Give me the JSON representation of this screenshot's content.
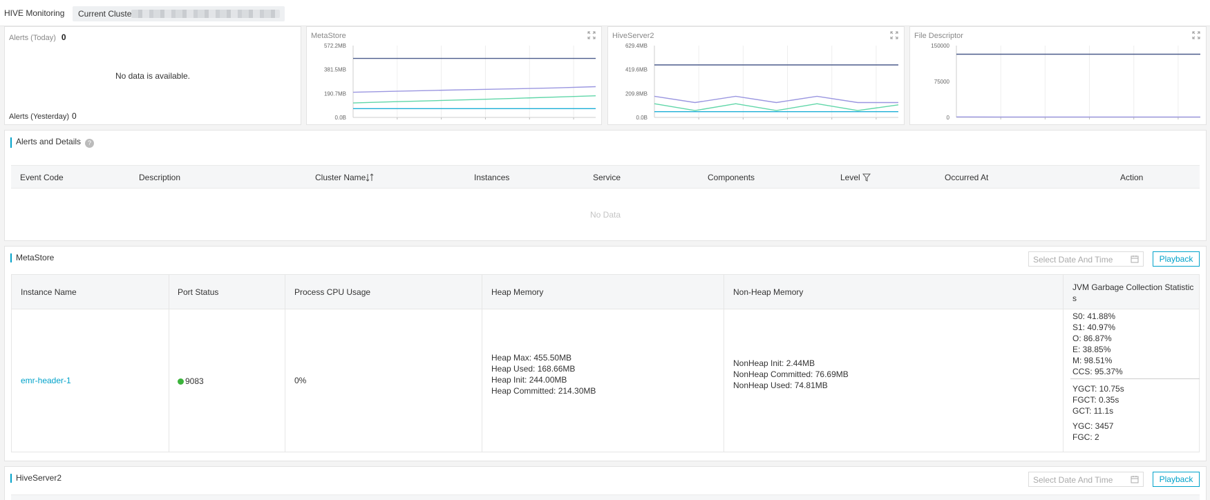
{
  "topbar": {
    "title": "HIVE Monitoring",
    "cluster_label": "Current Cluster"
  },
  "alerts_card": {
    "today_label": "Alerts (Today)",
    "today_count": "0",
    "no_data": "No data is available.",
    "yesterday_label": "Alerts (Yesterday)",
    "yesterday_count": "0"
  },
  "charts": [
    {
      "title": "MetaStore",
      "yticks": [
        "572.2MB",
        "381.5MB",
        "190.7MB",
        "0.0B"
      ]
    },
    {
      "title": "HiveServer2",
      "yticks": [
        "629.4MB",
        "419.6MB",
        "209.8MB",
        "0.0B"
      ]
    },
    {
      "title": "File Descriptor",
      "yticks": [
        "150000",
        "75000",
        "0"
      ]
    }
  ],
  "chart_data": [
    {
      "type": "line",
      "title": "MetaStore",
      "ylim": [
        0,
        572.2
      ],
      "yunit": "MB",
      "x": [
        0,
        1,
        2,
        3,
        4,
        5,
        6
      ],
      "series": [
        {
          "color": "#4a5a8a",
          "values": [
            470,
            470,
            470,
            470,
            470,
            470,
            470
          ]
        },
        {
          "color": "#9a96e0",
          "values": [
            200,
            208,
            215,
            222,
            228,
            235,
            245
          ]
        },
        {
          "color": "#5fd6a8",
          "values": [
            115,
            125,
            133,
            142,
            152,
            162,
            172
          ]
        },
        {
          "color": "#1aaed6",
          "values": [
            70,
            70,
            70,
            70,
            70,
            70,
            70
          ]
        }
      ]
    },
    {
      "type": "line",
      "title": "HiveServer2",
      "ylim": [
        0,
        629.4
      ],
      "yunit": "MB",
      "x": [
        0,
        1,
        2,
        3,
        4,
        5,
        6
      ],
      "series": [
        {
          "color": "#4a5a8a",
          "values": [
            460,
            460,
            460,
            460,
            460,
            460,
            460
          ]
        },
        {
          "color": "#9a96e0",
          "values": [
            185,
            130,
            185,
            130,
            185,
            130,
            130
          ]
        },
        {
          "color": "#5fd6a8",
          "values": [
            120,
            60,
            120,
            60,
            120,
            60,
            110
          ]
        },
        {
          "color": "#1aaed6",
          "values": [
            50,
            50,
            50,
            50,
            50,
            50,
            50
          ]
        }
      ]
    },
    {
      "type": "line",
      "title": "File Descriptor",
      "ylim": [
        0,
        150000
      ],
      "x": [
        0,
        1,
        2,
        3,
        4,
        5,
        6
      ],
      "series": [
        {
          "color": "#4a5a8a",
          "values": [
            132000,
            132000,
            132000,
            132000,
            132000,
            132000,
            132000
          ]
        },
        {
          "color": "#9a96e0",
          "values": [
            1000,
            800,
            800,
            800,
            800,
            800,
            800
          ]
        }
      ]
    }
  ],
  "alerts_section": {
    "title": "Alerts and Details",
    "columns": [
      "Event Code",
      "Description",
      "Cluster Name",
      "Instances",
      "Service",
      "Components",
      "Level",
      "Occurred At",
      "Action"
    ],
    "no_data": "No Data"
  },
  "metastore": {
    "title": "MetaStore",
    "date_placeholder": "Select Date And Time",
    "playback": "Playback",
    "columns": [
      "Instance Name",
      "Port Status",
      "Process CPU Usage",
      "Heap Memory",
      "Non-Heap Memory",
      "JVM Garbage Collection Statistic",
      "s"
    ],
    "row": {
      "instance": "emr-header-1",
      "port": "9083",
      "cpu": "0%",
      "heap": [
        "Heap Max: 455.50MB",
        "Heap Used: 168.66MB",
        "Heap Init: 244.00MB",
        "Heap Committed: 214.30MB"
      ],
      "nonheap": [
        "NonHeap Init: 2.44MB",
        "NonHeap Committed: 76.69MB",
        "NonHeap Used: 74.81MB"
      ],
      "gc1": [
        "S0: 41.88%",
        "S1: 40.97%",
        "O: 86.87%",
        "E: 38.85%",
        "M: 98.51%",
        "CCS: 95.37%"
      ],
      "gc2": [
        "YGCT: 10.75s",
        "FGCT: 0.35s",
        "GCT: 11.1s"
      ],
      "gc3": [
        "YGC: 3457",
        "FGC: 2"
      ]
    }
  },
  "hiveserver2": {
    "title": "HiveServer2",
    "date_placeholder": "Select Date And Time",
    "playback": "Playback"
  }
}
